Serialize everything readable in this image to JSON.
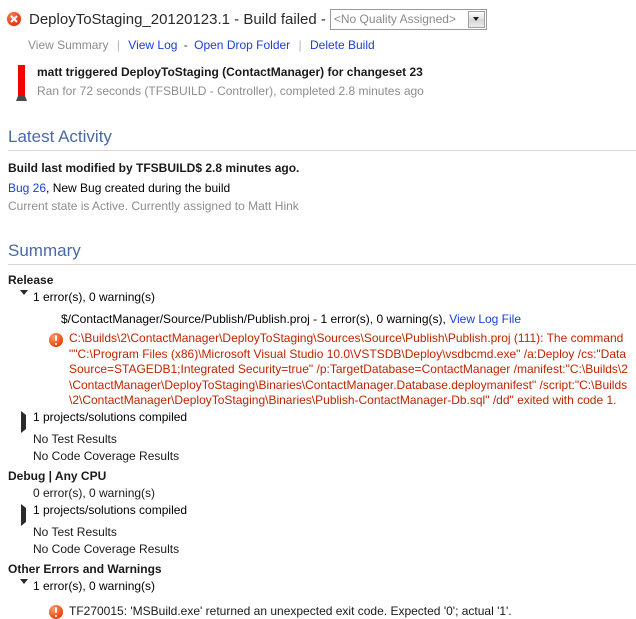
{
  "header": {
    "status_icon": "error-circle-icon",
    "title": "DeployToStaging_20120123.1 - Build failed -",
    "quality_value": "<No Quality Assigned>",
    "quality_arrow_icon": "chevron-down-icon"
  },
  "commands": {
    "view_summary": "View Summary",
    "view_log": "View Log",
    "open_drop_folder": "Open Drop Folder",
    "delete_build": "Delete Build",
    "separator": "|",
    "dash": "-"
  },
  "build_info": {
    "trigger_line_prefix": "matt",
    "trigger_line": "matt triggered DeployToStaging (ContactManager) for changeset 23",
    "run_line": "Ran for 72 seconds (TFSBUILD - Controller), completed 2.8 minutes ago"
  },
  "latest_activity": {
    "heading": "Latest Activity",
    "modified_line": "Build last modified by TFSBUILD$ 2.8 minutes ago.",
    "bug_link": "Bug 26",
    "bug_rest": ", New Bug created during the build",
    "bug_state": "Current state is Active. Currently assigned to Matt Hink"
  },
  "summary": {
    "heading": "Summary",
    "configurations": [
      {
        "name": "Release",
        "errors_warnings": "1 error(s), 0 warning(s)",
        "expanded": true,
        "project_line": "$/ContactManager/Source/Publish/Publish.proj - 1 error(s), 0 warning(s),",
        "project_log_link": "View Log File",
        "error_text": "C:\\Builds\\2\\ContactManager\\DeployToStaging\\Sources\\Source\\Publish\\Publish.proj (111): The command \"\"C:\\Program Files (x86)\\Microsoft Visual Studio 10.0\\VSTSDB\\Deploy\\vsdbcmd.exe\" /a:Deploy /cs:\"Data Source=STAGEDB1;Integrated Security=true\" /p:TargetDatabase=ContactManager /manifest:\"C:\\Builds\\2\\ContactManager\\DeployToStaging\\Binaries\\ContactManager.Database.deploymanifest\" /script:\"C:\\Builds\\2\\ContactManager\\DeployToStaging\\Binaries\\Publish-ContactManager-Db.sql\" /dd\" exited with code 1.",
        "projects_compiled": "1 projects/solutions compiled",
        "test_results": "No Test Results",
        "code_coverage": "No Code Coverage Results"
      },
      {
        "name": "Debug | Any CPU",
        "errors_warnings": "0 error(s), 0 warning(s)",
        "expanded": false,
        "projects_compiled": "1 projects/solutions compiled",
        "test_results": "No Test Results",
        "code_coverage": "No Code Coverage Results"
      }
    ],
    "other_errors": {
      "name": "Other Errors and Warnings",
      "errors_warnings": "1 error(s), 0 warning(s)",
      "error_text": "TF270015: 'MSBuild.exe' returned an unexpected exit code. Expected '0'; actual '1'."
    }
  },
  "colors": {
    "link": "#1a3fd4",
    "heading": "#4a6aa5",
    "error_red": "#c02400",
    "muted": "#8d8d8d",
    "status_bar_red": "#f50000"
  }
}
